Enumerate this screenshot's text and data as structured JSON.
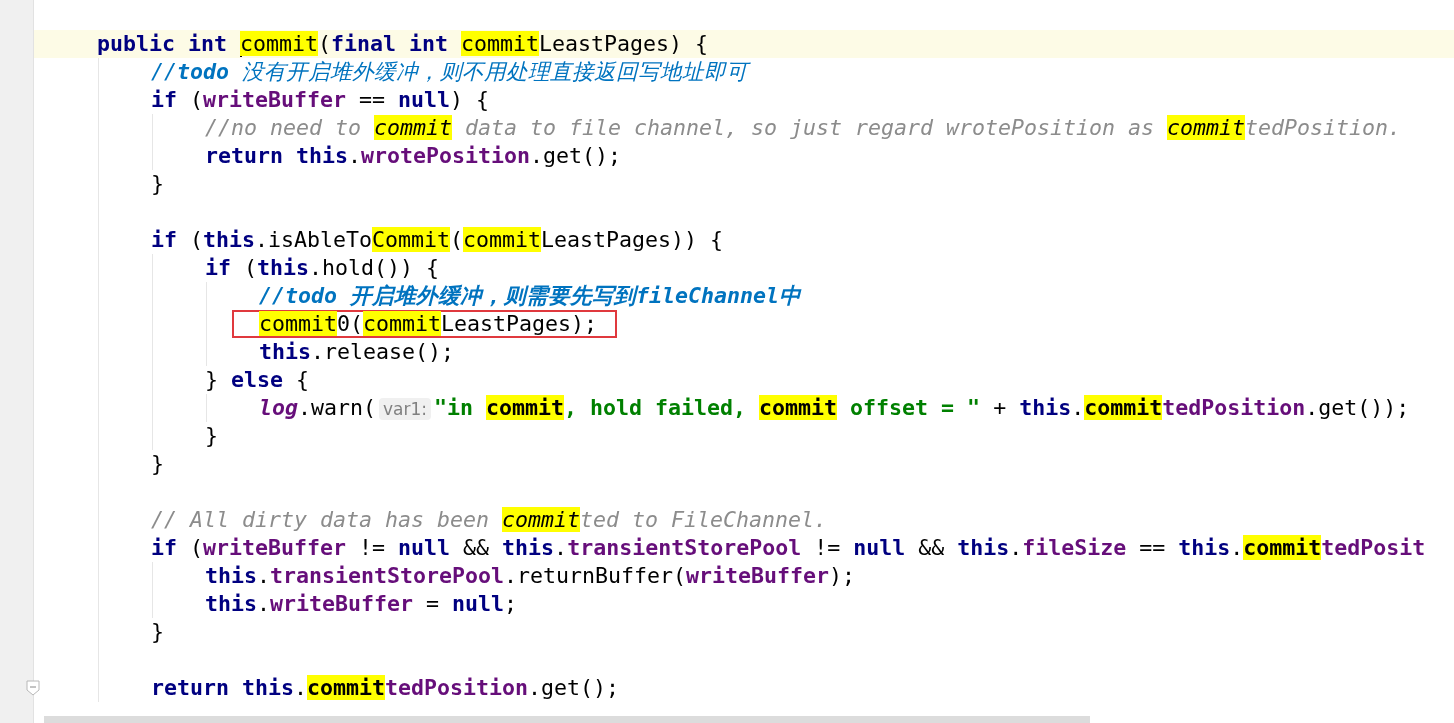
{
  "editor": {
    "lines": [
      {
        "kind": "code",
        "current": true,
        "boxed": false,
        "tokens": [
          {
            "kind": "kw",
            "text": "public int "
          },
          {
            "kind": "caret"
          },
          {
            "kind": "hl",
            "text": "commit"
          },
          {
            "kind": "plain",
            "text": "("
          },
          {
            "kind": "kw",
            "text": "final int "
          },
          {
            "kind": "hl",
            "text": "commit"
          },
          {
            "kind": "plain",
            "text": "LeastPages) {"
          }
        ],
        "children": [
          {
            "kind": "code",
            "current": false,
            "boxed": false,
            "tokens": [
              {
                "kind": "todo",
                "text": "//"
              },
              {
                "kind": "todo-b",
                "text": "todo"
              },
              {
                "kind": "todo",
                "text": " 没有开启堆外缓冲，则不用处理直接返回写地址即可"
              }
            ]
          },
          {
            "kind": "code",
            "current": false,
            "boxed": false,
            "tokens": [
              {
                "kind": "kw",
                "text": "if"
              },
              {
                "kind": "plain",
                "text": " ("
              },
              {
                "kind": "field",
                "text": "writeBuffer"
              },
              {
                "kind": "plain",
                "text": " == "
              },
              {
                "kind": "kw",
                "text": "null"
              },
              {
                "kind": "plain",
                "text": ") {"
              }
            ],
            "children": [
              {
                "kind": "code",
                "current": false,
                "boxed": false,
                "tokens": [
                  {
                    "kind": "comment",
                    "text": "//no need to "
                  },
                  {
                    "kind": "hl-comment",
                    "text": "commit"
                  },
                  {
                    "kind": "comment",
                    "text": " data to file channel, so just regard wrotePosition as "
                  },
                  {
                    "kind": "hl-comment",
                    "text": "commit"
                  },
                  {
                    "kind": "comment",
                    "text": "tedPosition."
                  }
                ]
              },
              {
                "kind": "code",
                "current": false,
                "boxed": false,
                "tokens": [
                  {
                    "kind": "kw",
                    "text": "return this"
                  },
                  {
                    "kind": "plain",
                    "text": "."
                  },
                  {
                    "kind": "field",
                    "text": "wrotePosition"
                  },
                  {
                    "kind": "plain",
                    "text": ".get();"
                  }
                ]
              }
            ]
          },
          {
            "kind": "code",
            "current": false,
            "boxed": false,
            "tokens": [
              {
                "kind": "plain",
                "text": "}"
              }
            ]
          },
          {
            "kind": "blank"
          },
          {
            "kind": "code",
            "current": false,
            "boxed": false,
            "tokens": [
              {
                "kind": "kw",
                "text": "if"
              },
              {
                "kind": "plain",
                "text": " ("
              },
              {
                "kind": "kw",
                "text": "this"
              },
              {
                "kind": "plain",
                "text": ".isAbleTo"
              },
              {
                "kind": "hl",
                "text": "Commit"
              },
              {
                "kind": "plain",
                "text": "("
              },
              {
                "kind": "hl",
                "text": "commit"
              },
              {
                "kind": "plain",
                "text": "LeastPages)) {"
              }
            ],
            "children": [
              {
                "kind": "code",
                "current": false,
                "boxed": false,
                "tokens": [
                  {
                    "kind": "kw",
                    "text": "if"
                  },
                  {
                    "kind": "plain",
                    "text": " ("
                  },
                  {
                    "kind": "kw",
                    "text": "this"
                  },
                  {
                    "kind": "plain",
                    "text": ".hold()) {"
                  }
                ],
                "children": [
                  {
                    "kind": "code",
                    "current": false,
                    "boxed": false,
                    "tokens": [
                      {
                        "kind": "todo-b",
                        "text": "//todo 开启堆外缓冲，则需要先写到fileChannel中"
                      }
                    ]
                  },
                  {
                    "kind": "code",
                    "current": false,
                    "boxed": true,
                    "tokens": [
                      {
                        "kind": "hl",
                        "text": "commit"
                      },
                      {
                        "kind": "plain",
                        "text": "0("
                      },
                      {
                        "kind": "hl",
                        "text": "commit"
                      },
                      {
                        "kind": "plain",
                        "text": "LeastPages);"
                      }
                    ]
                  },
                  {
                    "kind": "code",
                    "current": false,
                    "boxed": false,
                    "tokens": [
                      {
                        "kind": "kw",
                        "text": "this"
                      },
                      {
                        "kind": "plain",
                        "text": ".release();"
                      }
                    ]
                  }
                ]
              },
              {
                "kind": "code",
                "current": false,
                "boxed": false,
                "tokens": [
                  {
                    "kind": "plain",
                    "text": "} "
                  },
                  {
                    "kind": "kw",
                    "text": "else"
                  },
                  {
                    "kind": "plain",
                    "text": " {"
                  }
                ],
                "children": [
                  {
                    "kind": "code",
                    "current": false,
                    "boxed": false,
                    "tokens": [
                      {
                        "kind": "static",
                        "text": "log"
                      },
                      {
                        "kind": "plain",
                        "text": ".warn("
                      },
                      {
                        "kind": "hint",
                        "text": "var1:"
                      },
                      {
                        "kind": "str",
                        "text": "\"in "
                      },
                      {
                        "kind": "hl-str",
                        "text": "commit"
                      },
                      {
                        "kind": "str",
                        "text": ", hold failed, "
                      },
                      {
                        "kind": "hl-str",
                        "text": "commit"
                      },
                      {
                        "kind": "str",
                        "text": " offset = \""
                      },
                      {
                        "kind": "plain",
                        "text": " + "
                      },
                      {
                        "kind": "kw",
                        "text": "this"
                      },
                      {
                        "kind": "plain",
                        "text": "."
                      },
                      {
                        "kind": "hl-field",
                        "text": "commit"
                      },
                      {
                        "kind": "field",
                        "text": "tedPosition"
                      },
                      {
                        "kind": "plain",
                        "text": ".get());"
                      }
                    ]
                  }
                ]
              },
              {
                "kind": "code",
                "current": false,
                "boxed": false,
                "tokens": [
                  {
                    "kind": "plain",
                    "text": "}"
                  }
                ]
              }
            ]
          },
          {
            "kind": "code",
            "current": false,
            "boxed": false,
            "tokens": [
              {
                "kind": "plain",
                "text": "}"
              }
            ]
          },
          {
            "kind": "blank"
          },
          {
            "kind": "code",
            "current": false,
            "boxed": false,
            "tokens": [
              {
                "kind": "comment",
                "text": "// All dirty data has been "
              },
              {
                "kind": "hl-comment",
                "text": "commit"
              },
              {
                "kind": "comment",
                "text": "ted to FileChannel."
              }
            ]
          },
          {
            "kind": "code",
            "current": false,
            "boxed": false,
            "tokens": [
              {
                "kind": "kw",
                "text": "if"
              },
              {
                "kind": "plain",
                "text": " ("
              },
              {
                "kind": "field",
                "text": "writeBuffer"
              },
              {
                "kind": "plain",
                "text": " != "
              },
              {
                "kind": "kw",
                "text": "null"
              },
              {
                "kind": "plain",
                "text": " && "
              },
              {
                "kind": "kw",
                "text": "this"
              },
              {
                "kind": "plain",
                "text": "."
              },
              {
                "kind": "field",
                "text": "transientStorePool"
              },
              {
                "kind": "plain",
                "text": " != "
              },
              {
                "kind": "kw",
                "text": "null"
              },
              {
                "kind": "plain",
                "text": " && "
              },
              {
                "kind": "kw",
                "text": "this"
              },
              {
                "kind": "plain",
                "text": "."
              },
              {
                "kind": "field",
                "text": "fileSize"
              },
              {
                "kind": "plain",
                "text": " == "
              },
              {
                "kind": "kw",
                "text": "this"
              },
              {
                "kind": "plain",
                "text": "."
              },
              {
                "kind": "hl-field",
                "text": "commit"
              },
              {
                "kind": "field",
                "text": "tedPosit"
              }
            ],
            "children": [
              {
                "kind": "code",
                "current": false,
                "boxed": false,
                "tokens": [
                  {
                    "kind": "kw",
                    "text": "this"
                  },
                  {
                    "kind": "plain",
                    "text": "."
                  },
                  {
                    "kind": "field",
                    "text": "transientStorePool"
                  },
                  {
                    "kind": "plain",
                    "text": ".returnBuffer("
                  },
                  {
                    "kind": "field",
                    "text": "writeBuffer"
                  },
                  {
                    "kind": "plain",
                    "text": ");"
                  }
                ]
              },
              {
                "kind": "code",
                "current": false,
                "boxed": false,
                "tokens": [
                  {
                    "kind": "kw",
                    "text": "this"
                  },
                  {
                    "kind": "plain",
                    "text": "."
                  },
                  {
                    "kind": "field",
                    "text": "writeBuffer"
                  },
                  {
                    "kind": "plain",
                    "text": " = "
                  },
                  {
                    "kind": "kw",
                    "text": "null"
                  },
                  {
                    "kind": "plain",
                    "text": ";"
                  }
                ]
              }
            ]
          },
          {
            "kind": "code",
            "current": false,
            "boxed": false,
            "tokens": [
              {
                "kind": "plain",
                "text": "}"
              }
            ]
          },
          {
            "kind": "blank"
          },
          {
            "kind": "code",
            "current": false,
            "boxed": false,
            "tokens": [
              {
                "kind": "kw",
                "text": "return this"
              },
              {
                "kind": "plain",
                "text": "."
              },
              {
                "kind": "hl-field",
                "text": "commit"
              },
              {
                "kind": "field",
                "text": "tedPosition"
              },
              {
                "kind": "plain",
                "text": ".get();"
              }
            ]
          }
        ]
      }
    ]
  }
}
